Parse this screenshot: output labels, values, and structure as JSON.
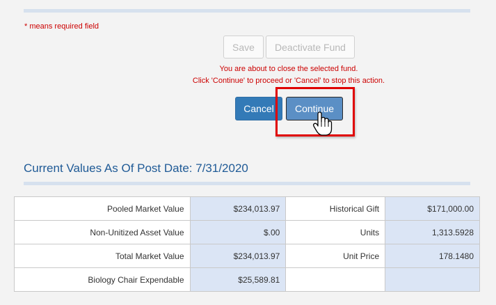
{
  "form": {
    "required_note": "* means required field",
    "save_label": "Save",
    "deactivate_label": "Deactivate Fund",
    "warning_line1": "You are about to close the selected fund.",
    "warning_line2": "Click 'Continue' to proceed or 'Cancel' to stop this action.",
    "cancel_label": "Cancel",
    "continue_label": "Continue"
  },
  "values_section": {
    "title": "Current Values As Of Post Date: 7/31/2020",
    "rows": [
      {
        "label1": "Pooled Market Value",
        "value1": "$234,013.97",
        "label2": "Historical Gift",
        "value2": "$171,000.00"
      },
      {
        "label1": "Non-Unitized Asset Value",
        "value1": "$.00",
        "label2": "Units",
        "value2": "1,313.5928"
      },
      {
        "label1": "Total Market Value",
        "value1": "$234,013.97",
        "label2": "Unit Price",
        "value2": "178.1480"
      },
      {
        "label1": "Biology Chair Expendable",
        "value1": "$25,589.81",
        "label2": "",
        "value2": ""
      }
    ]
  },
  "colors": {
    "accent_blue": "#337ab7",
    "warning_red": "#cc0000",
    "highlight_red": "#e00000",
    "value_cell_bg": "#dbe5f5"
  },
  "icons": {
    "cursor": "hand-pointer-icon"
  }
}
